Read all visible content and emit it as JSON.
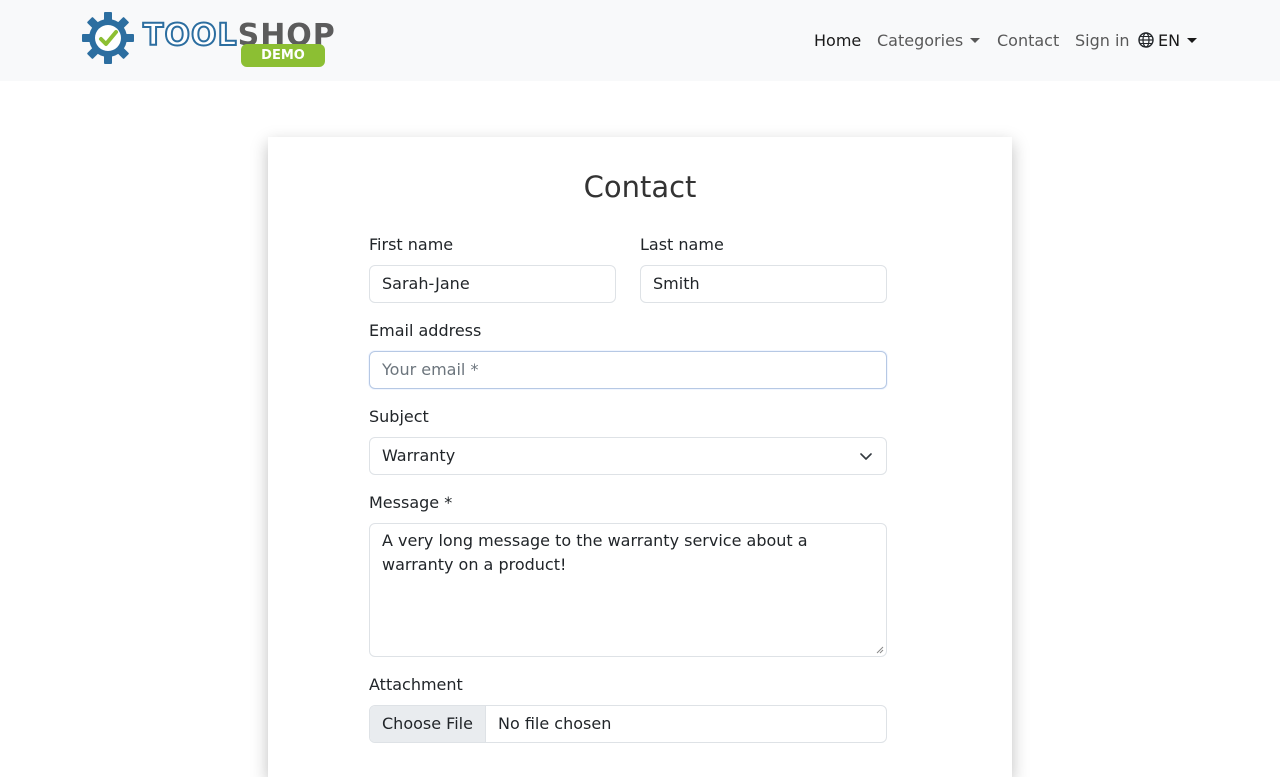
{
  "brand": {
    "logo_word_1": "TOOL",
    "logo_word_2": "SHOP",
    "badge": "DEMO",
    "gear_color": "#2c6ea0",
    "check_color": "#8cbf33",
    "badge_color": "#8cbf33"
  },
  "nav": {
    "home": "Home",
    "categories": "Categories",
    "contact": "Contact",
    "sign_in": "Sign in",
    "language": "EN",
    "language_icon": "globe-icon"
  },
  "form": {
    "title": "Contact",
    "first_name_label": "First name",
    "first_name_value": "Sarah-Jane",
    "last_name_label": "Last name",
    "last_name_value": "Smith",
    "email_label": "Email address",
    "email_placeholder": "Your email *",
    "email_value": "",
    "subject_label": "Subject",
    "subject_value": "Warranty",
    "message_label": "Message *",
    "message_value": "A very long message to the warranty service about a warranty on a product!",
    "attachment_label": "Attachment",
    "file_button": "Choose File",
    "file_status": "No file chosen"
  }
}
